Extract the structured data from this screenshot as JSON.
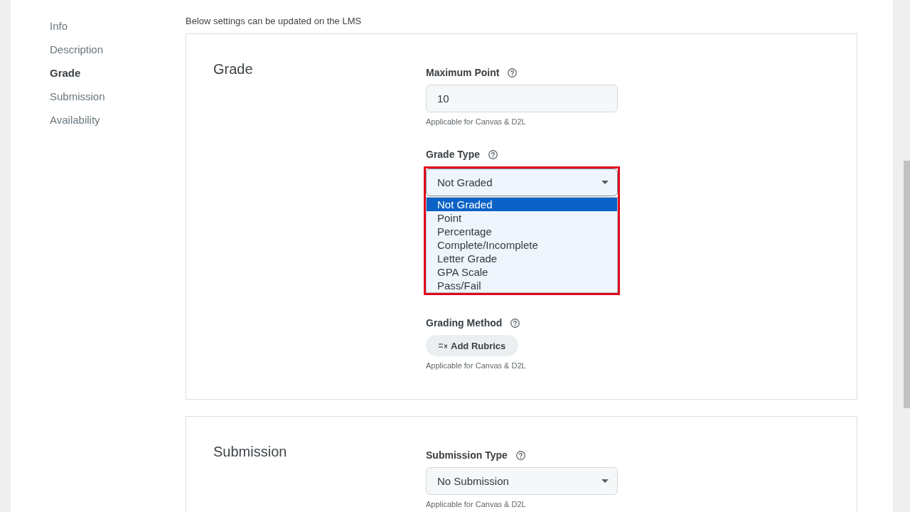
{
  "sidebar": {
    "items": [
      {
        "label": "Info",
        "selected": false
      },
      {
        "label": "Description",
        "selected": false
      },
      {
        "label": "Grade",
        "selected": true
      },
      {
        "label": "Submission",
        "selected": false
      },
      {
        "label": "Availability",
        "selected": false
      }
    ]
  },
  "notice": "Below settings can be updated on the LMS",
  "sections": [
    {
      "title": "Grade",
      "fields": [
        {
          "kind": "text",
          "label": "Maximum Point",
          "value": "10",
          "hint": "Applicable for Canvas & D2L"
        },
        {
          "kind": "select",
          "label": "Grade Type",
          "value": "Not Graded",
          "expanded": true,
          "highlighted": true,
          "options": [
            {
              "label": "Not Graded",
              "selected": true
            },
            {
              "label": "Point",
              "selected": false
            },
            {
              "label": "Percentage",
              "selected": false
            },
            {
              "label": "Complete/Incomplete",
              "selected": false
            },
            {
              "label": "Letter Grade",
              "selected": false
            },
            {
              "label": "GPA Scale",
              "selected": false
            },
            {
              "label": "Pass/Fail",
              "selected": false
            }
          ]
        },
        {
          "kind": "button",
          "label": "Grading Method",
          "button": "Add Rubrics",
          "hint": "Applicable for Canvas & D2L"
        }
      ]
    },
    {
      "title": "Submission",
      "fields": [
        {
          "kind": "select",
          "label": "Submission Type",
          "value": "No Submission",
          "expanded": false,
          "hint": "Applicable for Canvas & D2L"
        }
      ]
    }
  ]
}
